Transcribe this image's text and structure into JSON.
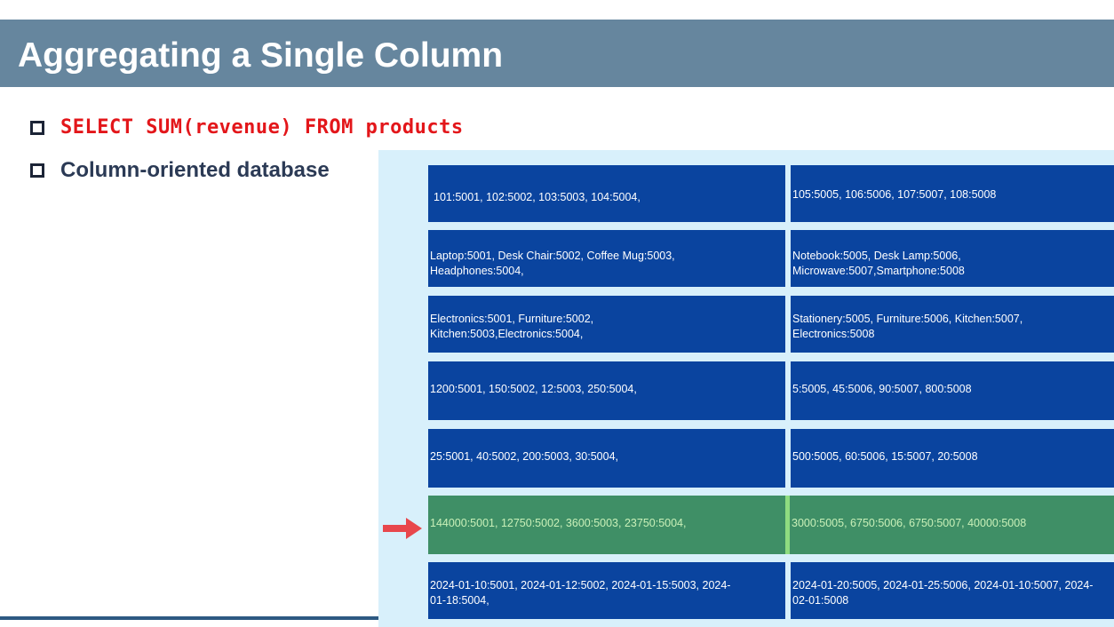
{
  "slide": {
    "title": "Aggregating a Single Column",
    "bullets": [
      {
        "text": "SELECT SUM(revenue) FROM products",
        "style": "code"
      },
      {
        "text": "Column-oriented database",
        "style": "plain"
      }
    ]
  },
  "columns_table": {
    "highlighted_row": 5,
    "highlight_indicator": "arrow-right-icon",
    "rows": [
      {
        "left": "101:5001, 102:5002, 103:5003, 104:5004,",
        "right": "105:5005, 106:5006, 107:5007, 108:5008"
      },
      {
        "left": "Laptop:5001, Desk Chair:5002, Coffee Mug:5003,\nHeadphones:5004,",
        "right": "Notebook:5005, Desk Lamp:5006,\nMicrowave:5007,Smartphone:5008"
      },
      {
        "left": "Electronics:5001, Furniture:5002,\nKitchen:5003,Electronics:5004,",
        "right": "Stationery:5005, Furniture:5006, Kitchen:5007,\nElectronics:5008"
      },
      {
        "left": "1200:5001, 150:5002, 12:5003, 250:5004,",
        "right": "5:5005, 45:5006, 90:5007, 800:5008"
      },
      {
        "left": "25:5001, 40:5002, 200:5003, 30:5004,",
        "right": "500:5005, 60:5006, 15:5007, 20:5008"
      },
      {
        "left": "144000:5001, 12750:5002, 3600:5003, 23750:5004,",
        "right": "3000:5005, 6750:5006, 6750:5007, 40000:5008"
      },
      {
        "left": "2024-01-10:5001, 2024-01-12:5002, 2024-01-15:5003, 2024-\n01-18:5004,",
        "right": "2024-01-20:5005, 2024-01-25:5006, 2024-01-10:5007, 2024-\n02-01:5008"
      }
    ]
  },
  "colors": {
    "title_bar": "#66869e",
    "cell": "#0a449f",
    "highlight": "#3f8f66",
    "arrow": "#e8474c",
    "code_text": "#e3161a"
  }
}
